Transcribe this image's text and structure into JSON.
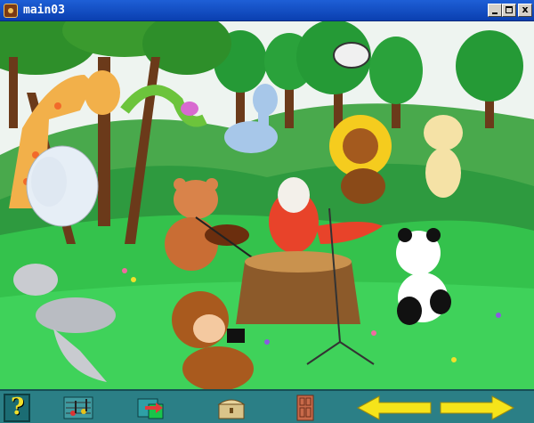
{
  "window": {
    "title": "main03",
    "minimize_glyph": "",
    "maximize_glyph": "",
    "close_glyph": "x"
  },
  "toolbar": {
    "help_glyph": "?",
    "icons": [
      "help-icon",
      "music-notes-icon",
      "switch-icon",
      "treasure-chest-icon",
      "door-icon",
      "arrow-left-icon",
      "arrow-right-icon"
    ]
  },
  "colors": {
    "titlebar": "#0a3fb0",
    "toolbar": "#2b7f86",
    "arrow": "#f5e41a",
    "grass": "#2fb84a",
    "sky": "#eef4f0"
  }
}
